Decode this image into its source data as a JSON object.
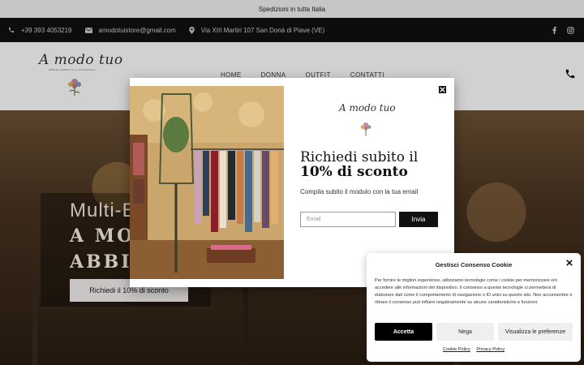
{
  "topbar": {
    "text": "Spedizioni in tutta Italia"
  },
  "contact": {
    "phone": "+39 393 4053219",
    "email": "amodotuistore@gmail.com",
    "address": "Via XIII Martiri 107 San Donà di Piave (VE)"
  },
  "header": {
    "logo": "A modo tuo",
    "logo_tagline": "ABBIGLIAMENTO & ACCESSORI",
    "nav": [
      "HOME",
      "DONNA",
      "OUTFIT",
      "CONTATTI"
    ]
  },
  "hero": {
    "line1": "Multi-B",
    "line2": "A MO",
    "line3": "ABBI",
    "button": "Richiedi il 10% di sconto"
  },
  "popup": {
    "logo": "A modo tuo",
    "heading1": "Richiedi subito il",
    "heading2": "10% di sconto",
    "subtext": "Compila subito il modulo con la tua email",
    "email_placeholder": "Email",
    "submit": "Invia"
  },
  "cookie": {
    "title": "Gestisci Consenso Cookie",
    "text": "Per fornire le migliori esperienze, utilizziamo tecnologie come i cookie per memorizzare e/o accedere alle informazioni del dispositivo. Il consenso a queste tecnologie ci permetterà di elaborare dati come il comportamento di navigazione o ID unici su questo sito. Non acconsentire o ritirare il consenso può influire negativamente su alcune caratteristiche e funzioni.",
    "accept": "Accetta",
    "deny": "Nega",
    "preferences": "Visualizza le preferenze",
    "policy_link": "Cookie Policy",
    "privacy_link": "Privacy Policy"
  },
  "icons": [
    "phone-icon",
    "mail-icon",
    "location-icon",
    "facebook-icon",
    "instagram-icon",
    "cart-phone-icon",
    "close-icon"
  ]
}
